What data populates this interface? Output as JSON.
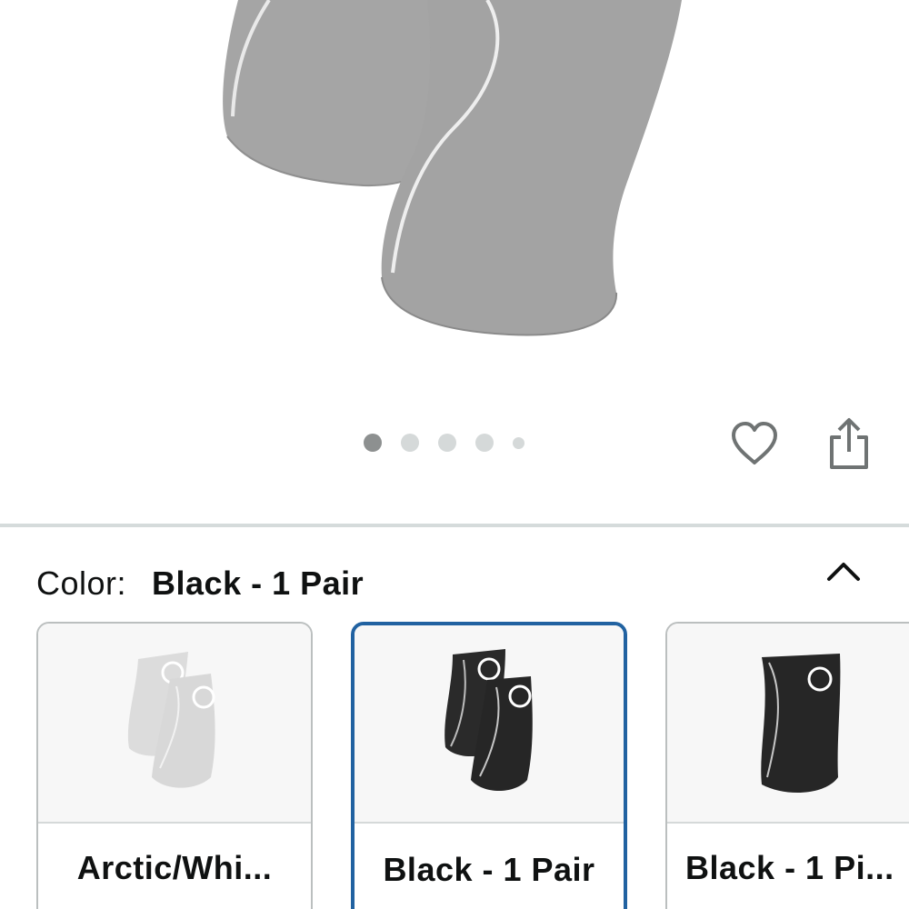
{
  "product": {
    "image_alt": "Knee sleeves product image",
    "carousel": {
      "count": 5,
      "active_index": 0
    }
  },
  "actions": {
    "wishlist_icon": "heart-icon",
    "share_icon": "share-icon"
  },
  "color_selector": {
    "label": "Color:",
    "selected": "Black - 1 Pair",
    "toggle_icon": "chevron-up-icon",
    "options": [
      {
        "label": "Arctic/Whi...",
        "variant": "white-pair",
        "selected": false
      },
      {
        "label": "Black - 1 Pair",
        "variant": "black-pair",
        "selected": true
      },
      {
        "label": "Black - 1 Pi...",
        "variant": "black-single",
        "selected": false
      }
    ]
  },
  "colors": {
    "selection_border": "#2162a1",
    "divider": "#d5dbdb",
    "text": "#0f1111"
  }
}
